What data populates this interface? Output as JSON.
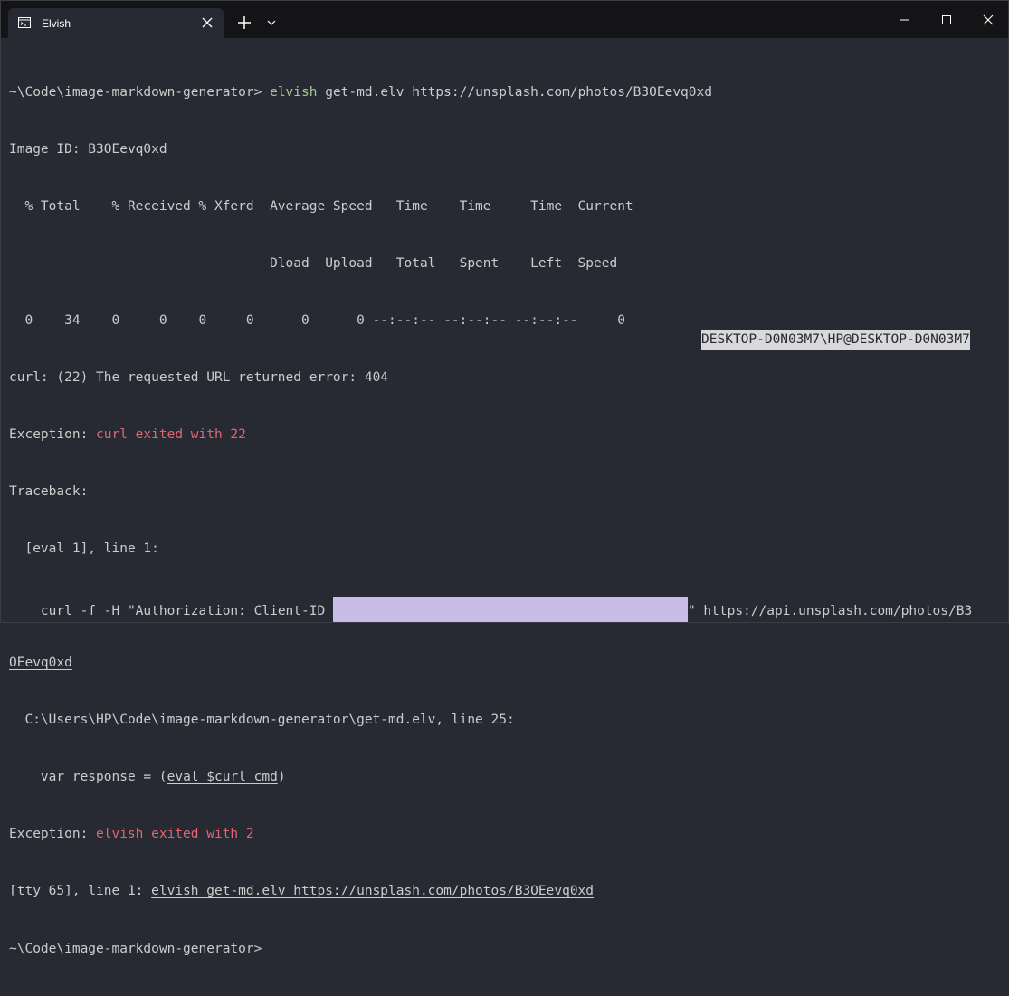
{
  "window": {
    "tab_title": "Elvish",
    "tab_icon": "terminal-icon"
  },
  "terminal": {
    "line1_prompt": "~\\Code\\image-markdown-generator> ",
    "line1_cmd": "elvish",
    "line1_args": " get-md.elv https://unsplash.com/photos/B3OEevq0xd",
    "line2": "Image ID: B3OEevq0xd",
    "line3": "  % Total    % Received % Xferd  Average Speed   Time    Time     Time  Current",
    "line4": "                                 Dload  Upload   Total   Spent    Left  Speed",
    "line5": "  0    34    0     0    0     0      0      0 --:--:-- --:--:-- --:--:--     0",
    "line6": "curl: (22) The requested URL returned error: 404",
    "line7_label": "Exception: ",
    "line7_msg": "curl exited with 22",
    "line8": "Traceback:",
    "line9": "  [eval 1], line 1:",
    "line10_indent": "    ",
    "line10_code_a": "curl -f -H \"Authorization: Client-ID ",
    "line10_code_b": "\" https://api.unsplash.com/photos/B3",
    "line11_code": "OEevq0xd",
    "line12": "  C:\\Users\\HP\\Code\\image-markdown-generator\\get-md.elv, line 25:",
    "line13_prefix": "    var response = (",
    "line13_code": "eval $curl_cmd",
    "line13_suffix": ")",
    "line14_label": "Exception: ",
    "line14_msg": "elvish exited with 2",
    "line15_prefix": "[tty 65], line 1: ",
    "line15_code": "elvish get-md.elv https://unsplash.com/photos/B3OEevq0xd",
    "line16_prompt": "~\\Code\\image-markdown-generator> ",
    "right_prompt": "DESKTOP-D0N03M7\\HP@DESKTOP-D0N03M7"
  },
  "colors": {
    "background": "#282a33",
    "titlebar": "#141416",
    "text": "#cccccc",
    "green": "#a8c991",
    "red": "#e0676f",
    "redaction": "#c9bce8"
  }
}
